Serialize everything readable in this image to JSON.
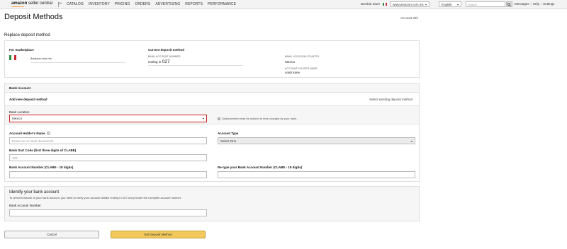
{
  "topbar": {
    "logo_bold": "amazon",
    "logo_rest": " seller central",
    "nav": [
      "CATALOG",
      "INVENTORY",
      "PRICING",
      "ORDERS",
      "ADVERTISING",
      "REPORTS",
      "PERFORMANCE"
    ],
    "store_name": "Bombia Store",
    "marketplace": "www.amazon.com.mx",
    "language": "English",
    "search_placeholder": "Search",
    "links": [
      "Messages",
      "Help",
      "Settings"
    ]
  },
  "page": {
    "title": "Deposit Methods",
    "account_info": "Account Info",
    "section_heading": "Replace deposit method"
  },
  "current": {
    "for_marketplace_label": "For marketplace",
    "marketplace_domain": "Amazon.com.mx",
    "current_label": "Current deposit method",
    "bank_account_number_label": "BANK ACCOUNT NUMBER",
    "bank_account_number_prefix": "ending in",
    "bank_account_number_value": "027",
    "bank_location_country_label": "BANK LOCATION COUNTRY",
    "bank_location_country_value": "Mexico",
    "account_holder_label": "ACCOUNT HOLDER NAME",
    "account_holder_value": "noah kane"
  },
  "bank_account": {
    "heading": "Bank Account",
    "add_new": "Add new deposit method",
    "select_existing": "Select existing deposit method",
    "bank_location_label": "Bank Location",
    "bank_location_value": "Mexico",
    "disbursement_note": "Disbursement may be subject to fees charged by your bank.",
    "holder_name_label": "Account Holder's Name",
    "holder_name_placeholder": "Name as on bank documents",
    "account_type_label": "Account Type",
    "account_type_value": "Select One",
    "sort_code_label": "Bank Sort Code (first three digits of CLABE)",
    "sort_code_placeholder": "123",
    "account_number_label": "Bank Account Number (CLABE - 18 digits)",
    "retype_label": "Re-type your Bank Account Number (CLABE - 18 digits)"
  },
  "identify": {
    "heading": "Identify your bank account",
    "note": "To prevent misuse of your bank account, you need to verify your account details ending in 027 and provide the complete account number.",
    "account_number_label": "Bank Account Number"
  },
  "buttons": {
    "cancel": "Cancel",
    "set": "Set Deposit Method"
  },
  "colors": {
    "accent_error": "#cc1f1f",
    "button_primary": "#f2c95a",
    "logo_smile": "#f0a03c"
  }
}
